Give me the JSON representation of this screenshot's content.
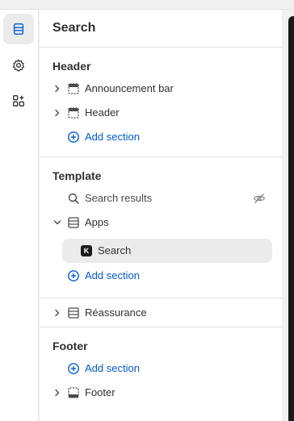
{
  "panel": {
    "title": "Search"
  },
  "rail": {
    "items": [
      {
        "icon": "sections-icon",
        "active": true
      },
      {
        "icon": "gear-icon",
        "active": false
      },
      {
        "icon": "apps-icon",
        "active": false
      }
    ]
  },
  "groups": {
    "header": {
      "title": "Header",
      "items": [
        {
          "label": "Announcement bar",
          "icon": "section-icon"
        },
        {
          "label": "Header",
          "icon": "section-icon"
        }
      ],
      "add_label": "Add section"
    },
    "template": {
      "title": "Template",
      "search_results": "Search results",
      "apps": "Apps",
      "block": {
        "badge": "K",
        "label": "Search"
      },
      "add_label": "Add section"
    },
    "reassurance": {
      "label": "Réassurance"
    },
    "footer": {
      "title": "Footer",
      "add_label": "Add section",
      "item": "Footer"
    }
  },
  "colors": {
    "accent": "#005bd3",
    "text": "#303030",
    "muted_bg": "#ebebeb"
  }
}
